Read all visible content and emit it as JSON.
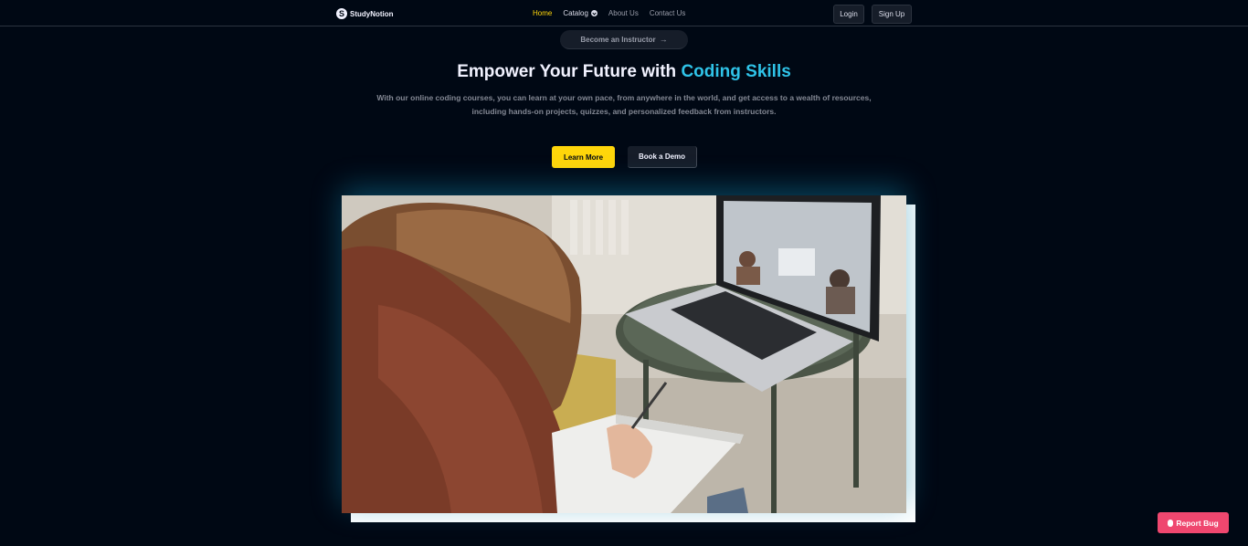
{
  "brand": {
    "name": "StudyNotion",
    "logo_letter": "S"
  },
  "nav": {
    "links": [
      {
        "label": "Home"
      },
      {
        "label": "Catalog"
      },
      {
        "label": "About Us"
      },
      {
        "label": "Contact Us"
      }
    ],
    "login_label": "Login",
    "signup_label": "Sign Up"
  },
  "instructor_pill": {
    "label": "Become an Instructor",
    "icon": "arrow-right-icon"
  },
  "hero": {
    "title_prefix": "Empower Your Future with ",
    "title_highlight": "Coding Skills",
    "subtitle": "With our online coding courses, you can learn at your own pace, from anywhere in the world, and get access to a wealth of resources, including hands-on projects, quizzes, and personalized feedback from instructors.",
    "cta_primary": "Learn More",
    "cta_secondary": "Book a Demo"
  },
  "report_bug": {
    "label": "Report Bug",
    "icon": "bug-icon"
  },
  "colors": {
    "background": "#000814",
    "accent_yellow": "#ffd60a",
    "accent_cyan": "#2fc3e8",
    "report_pink": "#ef476f"
  }
}
